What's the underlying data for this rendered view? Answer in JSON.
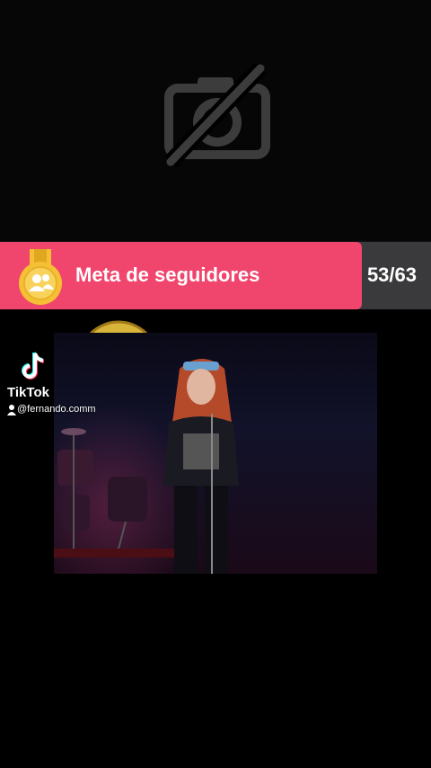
{
  "camera": {
    "icon": "camera-off-icon"
  },
  "goal": {
    "label": "Meta de seguidores",
    "count": "53/63",
    "current": 53,
    "target": 63,
    "progress_fraction": 0.84,
    "fill_color": "#f0456d",
    "track_color": "#3a3a3c",
    "medal_color": "#f5c033",
    "icon": "followers-medal-icon"
  },
  "video": {
    "description_icon": "concert-video"
  },
  "watermark": {
    "brand": "TikTok",
    "handle": "@fernando.comm",
    "icon": "tiktok-logo-icon"
  }
}
